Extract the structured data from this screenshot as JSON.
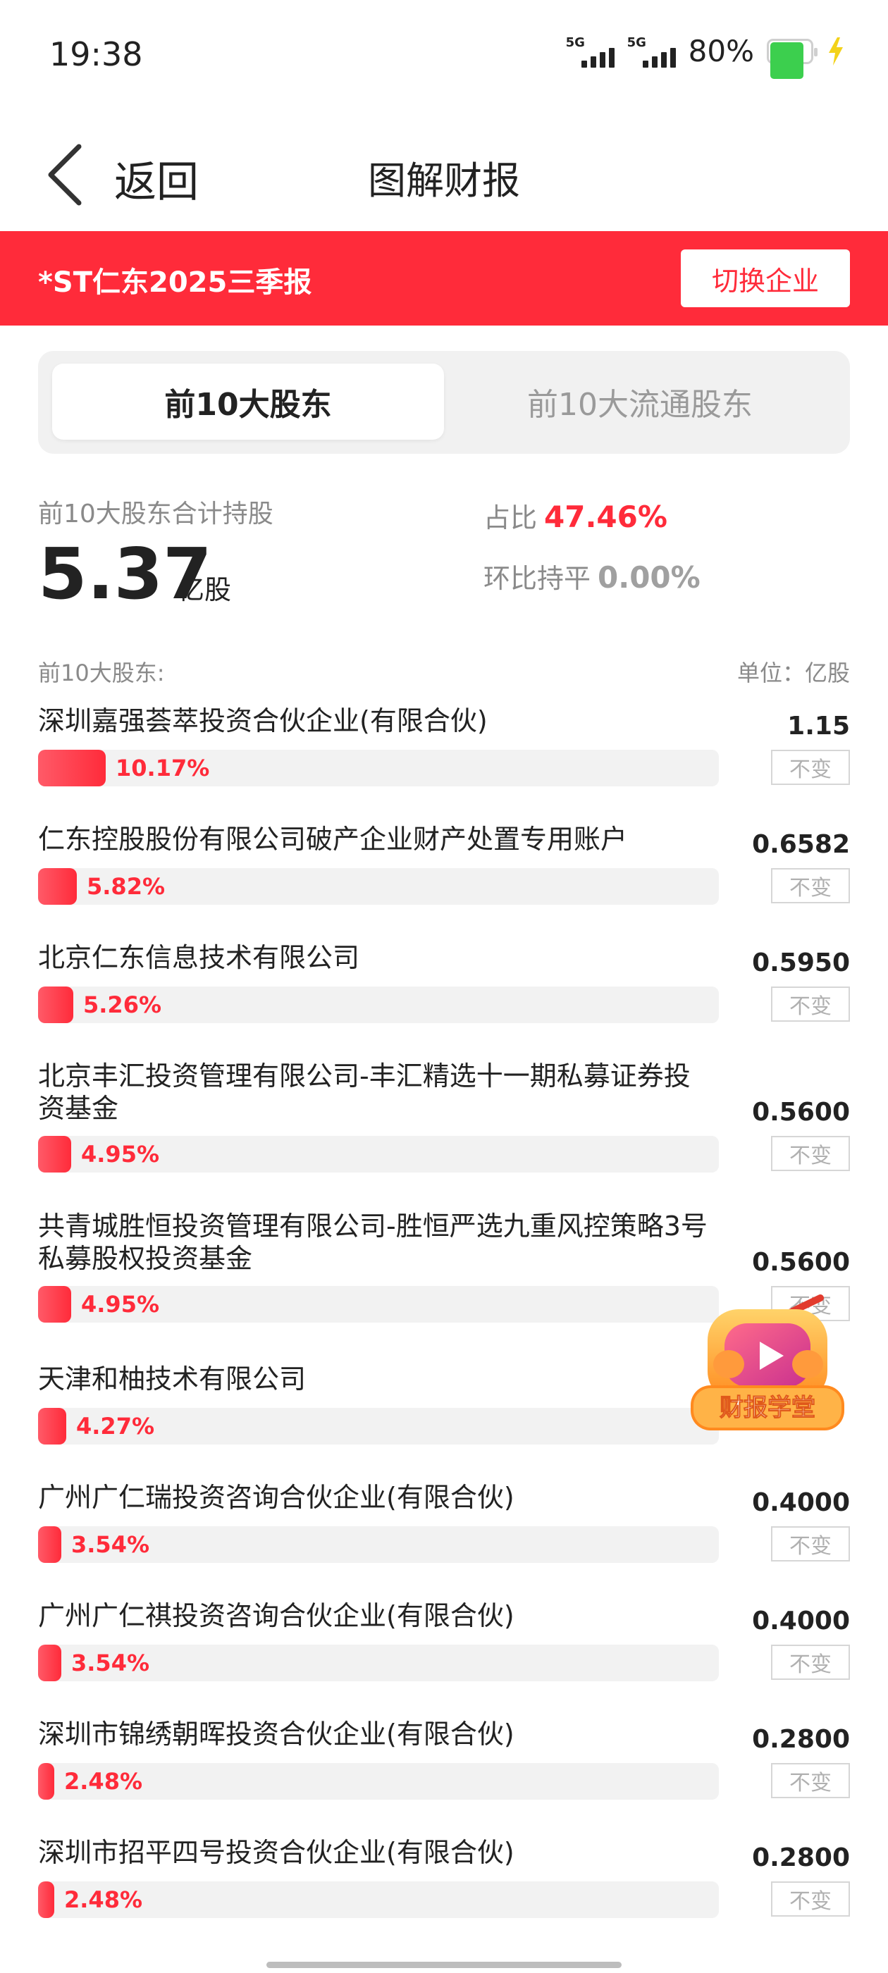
{
  "status_bar": {
    "time": "19:38",
    "sim1_tag": "5G",
    "sim2_tag": "5G",
    "battery_percent": "80%",
    "battery_level": 0.8
  },
  "nav": {
    "back_label": "返回",
    "title": "图解财报"
  },
  "banner": {
    "title": "*ST仁东2025三季报",
    "switch_label": "切换企业"
  },
  "tabs": [
    {
      "label": "前10大股东",
      "active": true
    },
    {
      "label": "前10大流通股东",
      "active": false
    }
  ],
  "summary": {
    "label": "前10大股东合计持股",
    "value": "5.37",
    "unit": "亿股",
    "ratio_label": "占比",
    "ratio_value": "47.46%",
    "qoq_label": "环比持平",
    "qoq_value": "0.00%"
  },
  "list": {
    "title": "前10大股东:",
    "unit_label": "单位：亿股",
    "rows": [
      {
        "name": "深圳嘉强荟萃投资合伙企业(有限合伙)",
        "value": "1.15",
        "percent": "10.17%",
        "pct_num": 10.17,
        "change": "不变"
      },
      {
        "name": "仁东控股股份有限公司破产企业财产处置专用账户",
        "value": "0.6582",
        "percent": "5.82%",
        "pct_num": 5.82,
        "change": "不变"
      },
      {
        "name": "北京仁东信息技术有限公司",
        "value": "0.5950",
        "percent": "5.26%",
        "pct_num": 5.26,
        "change": "不变"
      },
      {
        "name": "北京丰汇投资管理有限公司-丰汇精选十一期私募证券投资基金",
        "value": "0.5600",
        "percent": "4.95%",
        "pct_num": 4.95,
        "change": "不变"
      },
      {
        "name": "共青城胜恒投资管理有限公司-胜恒严选九重风控策略3号私募股权投资基金",
        "value": "0.5600",
        "percent": "4.95%",
        "pct_num": 4.95,
        "change": "不变"
      },
      {
        "name": "天津和柚技术有限公司",
        "value": "",
        "percent": "4.27%",
        "pct_num": 4.27,
        "change": ""
      },
      {
        "name": "广州广仁瑞投资咨询合伙企业(有限合伙)",
        "value": "0.4000",
        "percent": "3.54%",
        "pct_num": 3.54,
        "change": "不变"
      },
      {
        "name": "广州广仁祺投资咨询合伙企业(有限合伙)",
        "value": "0.4000",
        "percent": "3.54%",
        "pct_num": 3.54,
        "change": "不变"
      },
      {
        "name": "深圳市锦绣朝晖投资合伙企业(有限合伙)",
        "value": "0.2800",
        "percent": "2.48%",
        "pct_num": 2.48,
        "change": "不变"
      },
      {
        "name": "深圳市招平四号投资合伙企业(有限合伙)",
        "value": "0.2800",
        "percent": "2.48%",
        "pct_num": 2.48,
        "change": "不变"
      }
    ]
  },
  "floating_badge": {
    "label": "财报学堂"
  },
  "colors": {
    "accent": "#ff2b3a",
    "badge_orange": "#ff8a1f"
  }
}
